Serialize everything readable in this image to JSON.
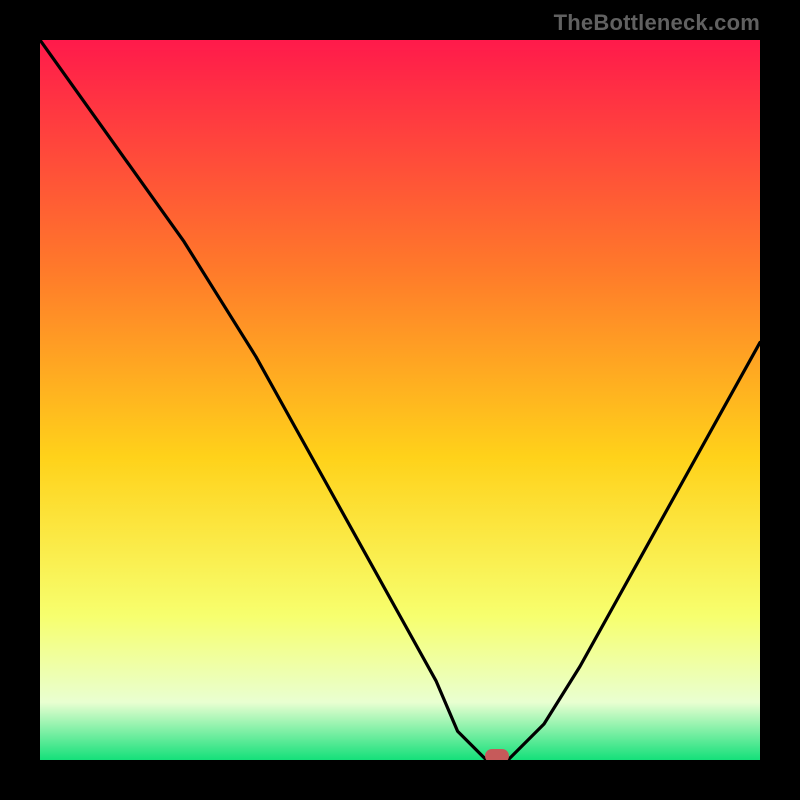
{
  "watermark": "TheBottleneck.com",
  "chart_data": {
    "type": "line",
    "title": "",
    "xlabel": "",
    "ylabel": "",
    "xlim": [
      0,
      100
    ],
    "ylim": [
      0,
      100
    ],
    "x": [
      0,
      5,
      10,
      15,
      20,
      25,
      30,
      35,
      40,
      45,
      50,
      55,
      58,
      62,
      65,
      70,
      75,
      80,
      85,
      90,
      95,
      100
    ],
    "values": [
      100,
      93,
      86,
      79,
      72,
      64,
      56,
      47,
      38,
      29,
      20,
      11,
      4,
      0,
      0,
      5,
      13,
      22,
      31,
      40,
      49,
      58
    ],
    "minimum_x": 63,
    "marker": {
      "x": 63.5,
      "y": 0
    },
    "gradient_colors": {
      "top": "#ff1a4b",
      "upper_mid": "#ff7a2a",
      "mid": "#ffd21a",
      "lower_mid": "#f7ff6e",
      "pale": "#e9ffd1",
      "bottom": "#14e07a"
    }
  }
}
